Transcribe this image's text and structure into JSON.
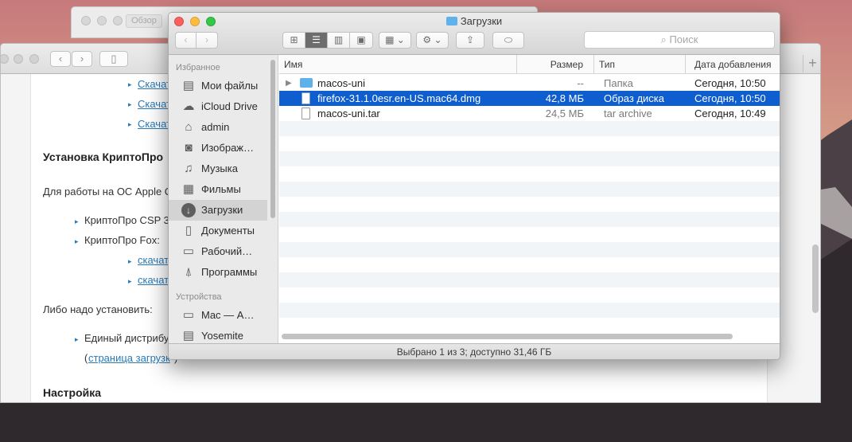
{
  "background_window": {
    "tab_label": "Обзор"
  },
  "browser": {
    "plus_label": "+",
    "links": [
      "Скачат",
      "Скачат",
      "Скачат"
    ],
    "heading1": "Установка КриптоПро",
    "para1": "Для работы на ОС Apple C",
    "li1": "КриптоПро CSP 3",
    "li2": "КриптоПро Fox:",
    "sublinks": [
      "скачат",
      "скачат"
    ],
    "para2": "Либо надо установить:",
    "li3": "Единый дистрибу",
    "li3_link_open": "(",
    "li3_link": "страница загрузк",
    "li3_link_close": ")",
    "heading2": "Настройка"
  },
  "finder": {
    "title": "Загрузки",
    "search_placeholder": "Поиск",
    "sidebar": {
      "favorites_header": "Избранное",
      "favorites": [
        {
          "label": "Мои файлы",
          "icon": "all-files-icon"
        },
        {
          "label": "iCloud Drive",
          "icon": "cloud-icon"
        },
        {
          "label": "admin",
          "icon": "home-icon"
        },
        {
          "label": "Изображ…",
          "icon": "camera-icon"
        },
        {
          "label": "Музыка",
          "icon": "music-icon"
        },
        {
          "label": "Фильмы",
          "icon": "film-icon"
        },
        {
          "label": "Загрузки",
          "icon": "download-icon"
        },
        {
          "label": "Документы",
          "icon": "document-icon"
        },
        {
          "label": "Рабочий…",
          "icon": "desktop-icon"
        },
        {
          "label": "Программы",
          "icon": "applications-icon"
        }
      ],
      "devices_header": "Устройства",
      "devices": [
        {
          "label": "Mac — А…",
          "icon": "computer-icon"
        },
        {
          "label": "Yosemite",
          "icon": "disk-icon"
        }
      ]
    },
    "columns": {
      "name": "Имя",
      "size": "Размер",
      "kind": "Тип",
      "date": "Дата добавления"
    },
    "files": [
      {
        "name": "macos-uni",
        "size": "--",
        "kind": "Папка",
        "date": "Сегодня, 10:50",
        "icon": "folder-icon",
        "selected": false
      },
      {
        "name": "firefox-31.1.0esr.en-US.mac64.dmg",
        "size": "42,8 МБ",
        "kind": "Образ диска",
        "date": "Сегодня, 10:50",
        "icon": "disk-image-icon",
        "selected": true
      },
      {
        "name": "macos-uni.tar",
        "size": "24,5 МБ",
        "kind": "tar archive",
        "date": "Сегодня, 10:49",
        "icon": "archive-icon",
        "selected": false
      }
    ],
    "status": "Выбрано 1 из 3; доступно 31,46 ГБ"
  },
  "colors": {
    "selection": "#0f5ecf",
    "folder": "#5fb1ec",
    "link": "#2a7ab8"
  }
}
